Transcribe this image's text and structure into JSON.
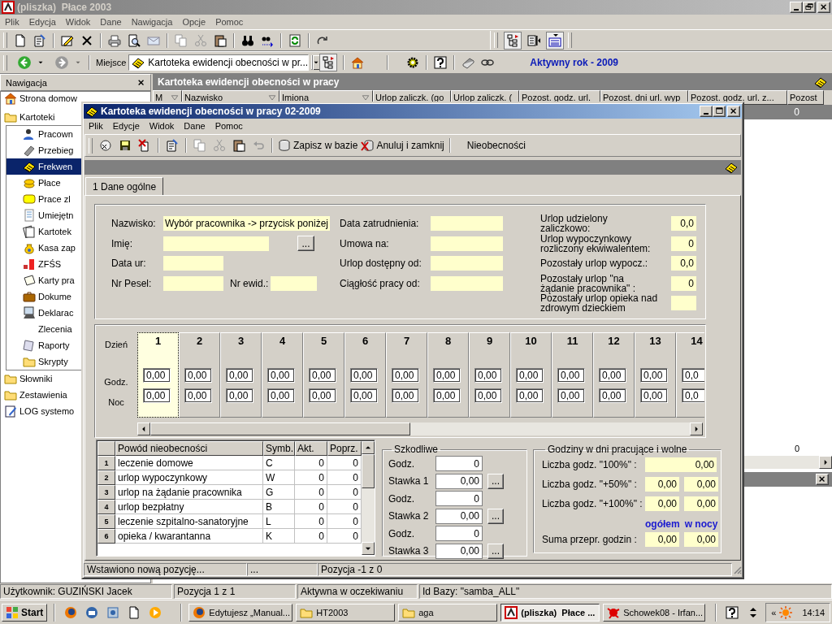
{
  "window": {
    "title": "(pliszka)  Płace 2003"
  },
  "menu": [
    "Plik",
    "Edycja",
    "Widok",
    "Dane",
    "Nawigacja",
    "Opcje",
    "Pomoc"
  ],
  "location_bar": {
    "label": "Miejsce",
    "value": "Kartoteka ewidencji obecności w pr...",
    "active_year": "Aktywny rok - 2009"
  },
  "navigation": {
    "title": "Nawigacja",
    "items": [
      {
        "label": "Strona domow",
        "selected": false
      },
      {
        "label": "Kartoteki",
        "selected": false,
        "children": [
          {
            "label": "Pracown",
            "selected": false
          },
          {
            "label": "Przebieg",
            "selected": false
          },
          {
            "label": "Frekwen",
            "selected": true
          },
          {
            "label": "Płace",
            "selected": false
          },
          {
            "label": "Prace zl",
            "selected": false
          },
          {
            "label": "Umiejętn",
            "selected": false
          },
          {
            "label": "Kartotek",
            "selected": false
          },
          {
            "label": "Kasa zap",
            "selected": false
          },
          {
            "label": "ZFŚS",
            "selected": false
          },
          {
            "label": "Karty pra",
            "selected": false
          },
          {
            "label": "Dokume",
            "selected": false
          },
          {
            "label": "Deklarac",
            "selected": false
          },
          {
            "label": "Zlecenia",
            "selected": false
          },
          {
            "label": "Raporty",
            "selected": false
          },
          {
            "label": "Skrypty",
            "selected": false
          }
        ]
      },
      {
        "label": "Słowniki",
        "selected": false
      },
      {
        "label": "Zestawienia",
        "selected": false
      },
      {
        "label": "LOG systemo",
        "selected": false
      }
    ]
  },
  "list": {
    "title": "Kartoteka ewidencji obecności w pracy",
    "columns": [
      {
        "label": "M",
        "filter": true
      },
      {
        "label": "Nazwisko",
        "filter": true
      },
      {
        "label": "Imiona",
        "filter": true
      },
      {
        "label": "Urlop zaliczk. (go",
        "filter": false
      },
      {
        "label": "Urlop zaliczk. (",
        "filter": false
      },
      {
        "label": "Pozost. godz. url.",
        "filter": false
      },
      {
        "label": "Pozost. dni url. wyp",
        "filter": false
      },
      {
        "label": "Pozost. godz. url. z...",
        "filter": false
      },
      {
        "label": "Pozost",
        "filter": false
      }
    ],
    "rows": [
      {
        "selected": true,
        "value": "0"
      }
    ],
    "total": "0"
  },
  "dialog": {
    "title": "Kartoteka ewidencji obecności w pracy 02-2009",
    "menu": [
      "Plik",
      "Edycje",
      "Widok",
      "Dane",
      "Pomoc"
    ],
    "toolbar": [
      "Zapisz w bazie",
      "Anuluj i zamknij",
      "Nieobecności"
    ],
    "tabs": [
      {
        "label": "1 Dane ogólne",
        "selected": true
      }
    ],
    "employee_left": [
      {
        "label": "Nazwisko:",
        "value": "Wybór pracownika -> przycisk poniżej"
      },
      {
        "label": "Imię:",
        "button": "..."
      },
      {
        "label": "Data ur:"
      },
      {
        "label": "Nr Pesel:",
        "extra_label": "Nr ewid.:"
      }
    ],
    "employee_middle": [
      {
        "label": "Data zatrudnienia:"
      },
      {
        "label": "Umowa na:"
      },
      {
        "label": "Urlop dostępny od:"
      },
      {
        "label": "Ciągłość pracy od:"
      }
    ],
    "employee_right": [
      {
        "label": "Urlop udzielony zaliczkowo:",
        "value": "0,0"
      },
      {
        "label": "Urlop wypoczynkowy rozliczony ekwiwalentem:",
        "value": "0"
      },
      {
        "label": "Pozostały urlop wypocz.:",
        "value": "0,0"
      },
      {
        "label": "Pozostały urlop \"na żądanie pracownika\" :",
        "value": "0"
      },
      {
        "label": "Pozostały urlop opieka nad zdrowym dzieckiem"
      }
    ],
    "days": {
      "row_labels": [
        "Dzień",
        "Godz.",
        "Noc"
      ],
      "items": [
        {
          "day": "1",
          "hours": "0,00",
          "night": "0,00",
          "selected": true
        },
        {
          "day": "2",
          "hours": "0,00",
          "night": "0,00",
          "selected": false
        },
        {
          "day": "3",
          "hours": "0,00",
          "night": "0,00",
          "selected": false
        },
        {
          "day": "4",
          "hours": "0,00",
          "night": "0,00",
          "selected": false
        },
        {
          "day": "5",
          "hours": "0,00",
          "night": "0,00",
          "selected": false
        },
        {
          "day": "6",
          "hours": "0,00",
          "night": "0,00",
          "selected": false
        },
        {
          "day": "7",
          "hours": "0,00",
          "night": "0,00",
          "selected": false
        },
        {
          "day": "8",
          "hours": "0,00",
          "night": "0,00",
          "selected": false
        },
        {
          "day": "9",
          "hours": "0,00",
          "night": "0,00",
          "selected": false
        },
        {
          "day": "10",
          "hours": "0,00",
          "night": "0,00",
          "selected": false
        },
        {
          "day": "11",
          "hours": "0,00",
          "night": "0,00",
          "selected": false
        },
        {
          "day": "12",
          "hours": "0,00",
          "night": "0,00",
          "selected": false
        },
        {
          "day": "13",
          "hours": "0,00",
          "night": "0,00",
          "selected": false
        },
        {
          "day": "14",
          "hours": "0,0",
          "night": "0,0",
          "selected": false
        }
      ]
    },
    "absences": {
      "columns": [
        "Powód nieobecności",
        "Symb.",
        "Akt.",
        "Poprz."
      ],
      "rows": [
        {
          "number": "1",
          "reason": "leczenie domowe",
          "symbol": "C",
          "current": "0",
          "previous": "0"
        },
        {
          "number": "2",
          "reason": "urlop wypoczynkowy",
          "symbol": "W",
          "current": "0",
          "previous": "0"
        },
        {
          "number": "3",
          "reason": "urlop na żądanie pracownika",
          "symbol": "G",
          "current": "0",
          "previous": "0"
        },
        {
          "number": "4",
          "reason": "urlop bezpłatny",
          "symbol": "B",
          "current": "0",
          "previous": "0"
        },
        {
          "number": "5",
          "reason": "leczenie szpitalno-sanatoryjne",
          "symbol": "L",
          "current": "0",
          "previous": "0"
        },
        {
          "number": "6",
          "reason": "opieka / kwarantanna",
          "symbol": "K",
          "current": "0",
          "previous": "0"
        }
      ]
    },
    "harmful": {
      "title": "Szkodliwe",
      "rows": [
        {
          "label": "Godz.",
          "value": "0"
        },
        {
          "label": "Stawka 1",
          "value": "0,00",
          "button": "..."
        },
        {
          "label": "Godz.",
          "value": "0"
        },
        {
          "label": "Stawka 2",
          "value": "0,00",
          "button": "..."
        },
        {
          "label": "Godz.",
          "value": "0"
        },
        {
          "label": "Stawka 3",
          "value": "0,00",
          "button": "..."
        }
      ]
    },
    "overtime": {
      "title": "Godziny w dni pracujące i wolne",
      "rows": [
        {
          "label": "Liczba godz. \"100%\" :",
          "total": "0,00"
        },
        {
          "label": "Liczba godz. \"+50%\" :",
          "total": "0,00",
          "night": "0,00"
        },
        {
          "label": "Liczba godz. \"+100%\" :",
          "total": "0,00",
          "night": "0,00"
        }
      ],
      "headers": [
        "ogółem",
        "w nocy"
      ],
      "sum": {
        "label": "Suma przepr. godzin :",
        "total": "0,00",
        "night": "0,00"
      }
    },
    "status_bar": [
      "Wstawiono nową pozycję...",
      "...",
      "Pozycja -1 z 0"
    ]
  },
  "status_bar": [
    "Użytkownik: GUZIŃSKI Jacek",
    "Pozycja 1 z 1",
    "Aktywna w oczekiwaniu",
    "Id Bazy: \"samba_ALL\""
  ],
  "taskbar": {
    "start": "Start",
    "tasks": [
      {
        "label": "Edytujesz „Manual...",
        "selected": false
      },
      {
        "label": "HT2003",
        "selected": false
      },
      {
        "label": "aga",
        "selected": false
      },
      {
        "label": "(pliszka)  Płace ...",
        "selected": true
      },
      {
        "label": "Schowek08 - Irfan...",
        "selected": false
      }
    ],
    "tray_toggle": "«",
    "clock": "14:14"
  }
}
